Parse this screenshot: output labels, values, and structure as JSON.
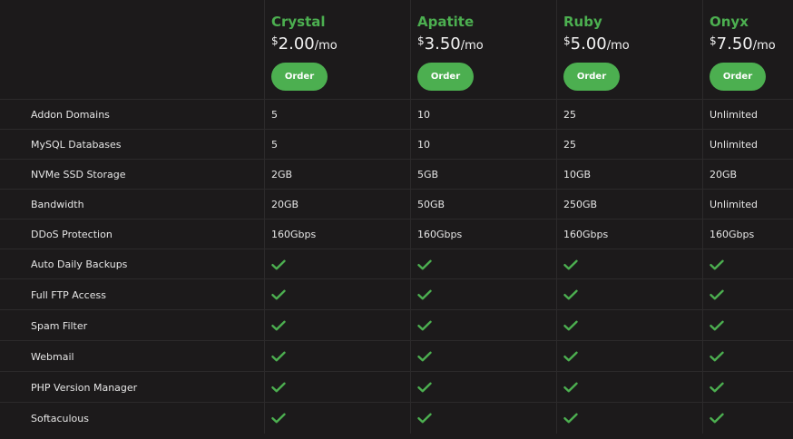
{
  "plans": [
    {
      "name": "Crystal",
      "currency": "$",
      "price": "2.00",
      "period": "/mo",
      "order_label": "Order"
    },
    {
      "name": "Apatite",
      "currency": "$",
      "price": "3.50",
      "period": "/mo",
      "order_label": "Order"
    },
    {
      "name": "Ruby",
      "currency": "$",
      "price": "5.00",
      "period": "/mo",
      "order_label": "Order"
    },
    {
      "name": "Onyx",
      "currency": "$",
      "price": "7.50",
      "period": "/mo",
      "order_label": "Order"
    }
  ],
  "features": [
    {
      "label": "Addon Domains",
      "values": [
        "5",
        "10",
        "25",
        "Unlimited"
      ]
    },
    {
      "label": "MySQL Databases",
      "values": [
        "5",
        "10",
        "25",
        "Unlimited"
      ]
    },
    {
      "label": "NVMe SSD Storage",
      "values": [
        "2GB",
        "5GB",
        "10GB",
        "20GB"
      ]
    },
    {
      "label": "Bandwidth",
      "values": [
        "20GB",
        "50GB",
        "250GB",
        "Unlimited"
      ]
    },
    {
      "label": "DDoS Protection",
      "values": [
        "160Gbps",
        "160Gbps",
        "160Gbps",
        "160Gbps"
      ]
    },
    {
      "label": "Auto Daily Backups",
      "values": [
        "check",
        "check",
        "check",
        "check"
      ]
    },
    {
      "label": "Full FTP Access",
      "values": [
        "check",
        "check",
        "check",
        "check"
      ]
    },
    {
      "label": "Spam Filter",
      "values": [
        "check",
        "check",
        "check",
        "check"
      ]
    },
    {
      "label": "Webmail",
      "values": [
        "check",
        "check",
        "check",
        "check"
      ]
    },
    {
      "label": "PHP Version Manager",
      "values": [
        "check",
        "check",
        "check",
        "check"
      ]
    },
    {
      "label": "Softaculous",
      "values": [
        "check",
        "check",
        "check",
        "check"
      ]
    }
  ],
  "colors": {
    "accent": "#4caf50",
    "background": "#1c1a1b",
    "divider": "#2c2a2b",
    "text": "#e6e6e6"
  },
  "icons": {
    "included": "check-icon"
  }
}
